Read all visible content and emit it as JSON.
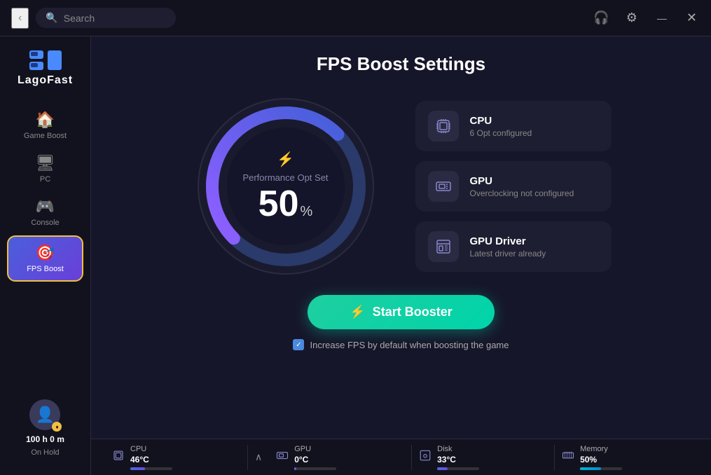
{
  "titlebar": {
    "back_label": "‹",
    "search_placeholder": "Search",
    "support_icon": "🎧",
    "settings_icon": "⚙",
    "minimize_label": "—",
    "close_label": "✕"
  },
  "sidebar": {
    "logo_text": "LagoFast",
    "nav_items": [
      {
        "id": "game-boost",
        "label": "Game Boost",
        "icon": "🏠",
        "active": false
      },
      {
        "id": "pc",
        "label": "PC",
        "icon": "🖥",
        "active": false
      },
      {
        "id": "console",
        "label": "Console",
        "icon": "🎮",
        "active": false
      },
      {
        "id": "fps-boost",
        "label": "FPS Boost",
        "icon": "🎯",
        "active": true
      }
    ],
    "avatar_icon": "👤",
    "avatar_badge": "♦",
    "time_hours": "100",
    "time_unit_h": "h",
    "time_minutes": "0",
    "time_unit_m": "m",
    "status_label": "On Hold"
  },
  "content": {
    "page_title": "FPS Boost Settings",
    "gauge": {
      "bolt_icon": "⚡",
      "label": "Performance Opt Set",
      "value": "50",
      "unit": "%"
    },
    "info_cards": [
      {
        "id": "cpu",
        "icon": "🔲",
        "title": "CPU",
        "subtitle": "6 Opt configured"
      },
      {
        "id": "gpu",
        "icon": "🖼",
        "title": "GPU",
        "subtitle": "Overclocking not configured"
      },
      {
        "id": "gpu-driver",
        "icon": "💾",
        "title": "GPU Driver",
        "subtitle": "Latest driver already"
      }
    ],
    "boost_button_label": "Start Booster",
    "boost_button_icon": "⚡",
    "checkbox_label": "Increase FPS by default when boosting the game",
    "checkbox_checked": true
  },
  "statusbar": {
    "chevron": "∧",
    "items": [
      {
        "id": "cpu-status",
        "icon": "🔲",
        "name": "CPU",
        "value": "46°C",
        "bar_percent": 35,
        "bar_type": "purple"
      },
      {
        "id": "gpu-status",
        "icon": "🖼",
        "name": "GPU",
        "value": "0°C",
        "bar_percent": 5,
        "bar_type": "purple"
      },
      {
        "id": "disk-status",
        "icon": "💾",
        "name": "Disk",
        "value": "33°C",
        "bar_percent": 25,
        "bar_type": "purple"
      },
      {
        "id": "memory-status",
        "icon": "🧠",
        "name": "Memory",
        "value": "50%",
        "bar_percent": 50,
        "bar_type": "teal"
      }
    ]
  }
}
